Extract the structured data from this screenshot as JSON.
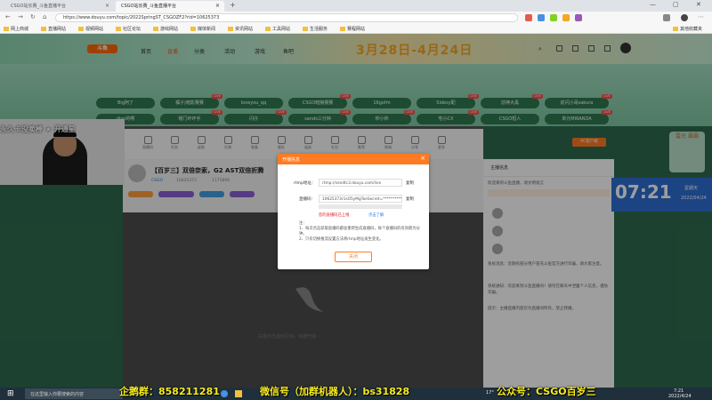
{
  "browser": {
    "tabs": [
      {
        "label": "CSGO站长赛_斗鱼直播平台"
      },
      {
        "label": "CSGO站长赛_斗鱼直播平台"
      }
    ],
    "url": "https://www.douyu.com/topic/2022SpringST_CSGOZF2?rid=10625373",
    "bookmarks": [
      "网上商城",
      "直播网站",
      "视频网站",
      "社区论坛",
      "游戏网站",
      "媒体新闻",
      "资讯网站",
      "工具网站",
      "生活服务",
      "赛程网站"
    ],
    "other_bookmarks": "其他收藏夹"
  },
  "site": {
    "logo": "斗鱼",
    "nav": [
      "首页",
      "直播",
      "分类",
      "活动",
      "游戏",
      "鱼吧"
    ],
    "banner_date": "3月28日-4月24日"
  },
  "event_pills": [
    [
      "Big阿了",
      "橘子|暗影赛赛",
      "loveyou_qq",
      "CSGO暗狼赛赛",
      "16gofm",
      "Sidesy配",
      "前神大黑",
      "前闪小哥sakura"
    ],
    [
      "diyy的啊",
      "帽门坏坏手",
      "闪仔",
      "sands三分钟",
      "帅小帅",
      "宅小CX",
      "CSGO短人",
      "单元MIRANDA"
    ]
  ],
  "toolbar": {
    "items": [
      "直播间",
      "任务",
      "皮肤",
      "礼物",
      "装备",
      "舰队",
      "道具",
      "礼包",
      "推荐",
      "商城",
      "分享",
      "更多"
    ],
    "pc_stream_label": "PC客户端"
  },
  "stream": {
    "title": "【百岁三】双倍奈索，G2 AST双倍折腾",
    "room_id": "10625373",
    "tags": [
      "CSGO",
      "1175899"
    ],
    "hint": "右键点击视频区域，快捷开播",
    "hint2": "主播暂未开播"
  },
  "chat": {
    "header": "主播信息",
    "welcome": "欢迎来到斗鱼直播，请文明发言",
    "messages": [
      "系统消息：近期有部分用户冒充斗鱼官方进行诈骗，请大家注意。",
      "系统通知：欢迎来到斗鱼直播间！请勿在聊天中泄露个人信息，谨防诈骗。",
      "提示：主播直播内容仅为直播间所有，禁止转播。"
    ]
  },
  "overlay": {
    "scroll_text": "永久卡没卖棒 ★ 开通星",
    "clock_time": "07:21",
    "clock_weekday": "星期天",
    "clock_date": "2022/04/24",
    "side_badge": "雷光 霸霸"
  },
  "modal": {
    "title": "开播信息",
    "rtmp_label": "rtmp地址：",
    "rtmp_value": "rtmp://sendtc3.douyu.com/live",
    "code_label": "直播码：",
    "code_value": "10625373r1sO5yMgToeSecret=**********",
    "copy": "复制",
    "warning": "您的直播码已上线",
    "link": "点击了解",
    "note_title": "注：",
    "notes": [
      "1、每次点击获取直播码都会重新生成直播码，每个直播码的有效期为分钟。",
      "2、只有切换推流设置方法将rtmp地址发生变化。"
    ],
    "close_button": "关闭"
  },
  "taskbar": {
    "search_placeholder": "在这里输入你要搜索的内容",
    "promo_left": "企鹅群：858211281",
    "promo_mid": "微信号（加群机器人）：bs31828",
    "promo_right": "公众号：CSGO百岁三",
    "weather": "17°",
    "time": "7:21",
    "date": "2022/4/24"
  }
}
